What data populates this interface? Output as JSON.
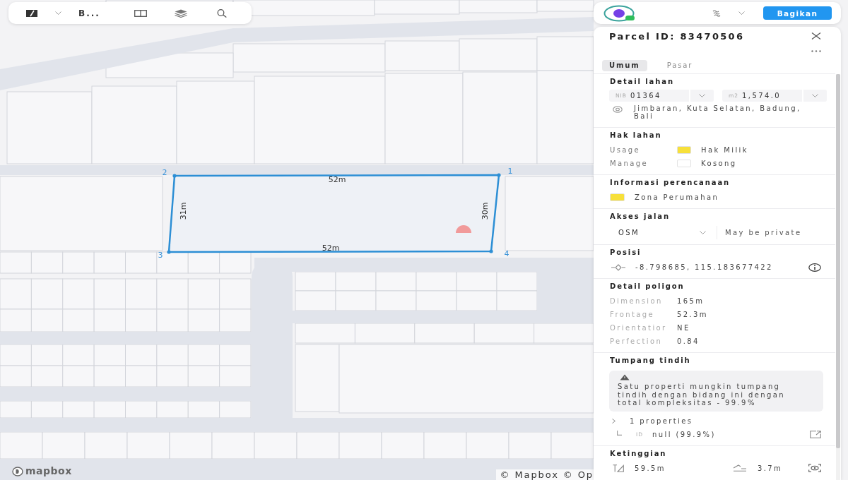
{
  "map_toolbar": {
    "project_name": "B..."
  },
  "header_bar": {
    "share_button": "Bagikan"
  },
  "map": {
    "parcel": {
      "vertices": [
        {
          "label": "2"
        },
        {
          "label": "1"
        },
        {
          "label": "3"
        },
        {
          "label": "4"
        }
      ],
      "edges": [
        {
          "label": "52m"
        },
        {
          "label": "31m"
        },
        {
          "label": "30m"
        },
        {
          "label": "52m"
        }
      ]
    },
    "logo_text": "mapbox",
    "attribution": "© Mapbox © Op"
  },
  "panel": {
    "title": "Parcel ID: 83470506",
    "tabs": [
      {
        "label": "Umum",
        "selected": true
      },
      {
        "label": "Pasar",
        "selected": false
      }
    ],
    "sections": [
      {
        "kind": "land_detail",
        "title": "Detail lahan",
        "selects": [
          {
            "prefix": "NIB",
            "value": "01364"
          },
          {
            "prefix": "m2",
            "value": "1,574.0"
          }
        ],
        "address": "Jimbaran, Kuta Selatan, Badung, Bali"
      },
      {
        "kind": "rights",
        "title": "Hak lahan",
        "rows": [
          {
            "label": "Usage",
            "color": "#f7e03a",
            "value": "Hak Milik"
          },
          {
            "label": "Manage",
            "color": "#ffffff",
            "value": "Kosong"
          }
        ]
      },
      {
        "kind": "planning",
        "title": "Informasi perencanaan",
        "zones": [
          {
            "color": "#f7e03a",
            "label": "Zona Perumahan"
          }
        ]
      },
      {
        "kind": "road_access",
        "title": "Akses jalan",
        "source": "OSM",
        "note": "May be private"
      },
      {
        "kind": "position",
        "title": "Posisi",
        "coordinates": "-8.798685, 115.183677422"
      },
      {
        "kind": "polygon",
        "title": "Detail poligon",
        "rows": [
          {
            "label": "Dimension",
            "value": "165m"
          },
          {
            "label": "Frontage",
            "value": "52.3m"
          },
          {
            "label": "Orientatior",
            "value": "NE"
          },
          {
            "label": "Perfection",
            "value": "0.84"
          }
        ]
      },
      {
        "kind": "overlap",
        "title": "Tumpang tindih",
        "warning": "Satu properti mungkin tumpang tindih dengan bidang ini dengan total kompleksitas - 99.9%",
        "group": {
          "label": "1 properties",
          "items": [
            {
              "key": "ID",
              "value": "null (99.9%)"
            }
          ]
        }
      },
      {
        "kind": "elevation",
        "title": "Ketinggian",
        "height": "59.5m",
        "slope": "3.7m"
      }
    ]
  }
}
